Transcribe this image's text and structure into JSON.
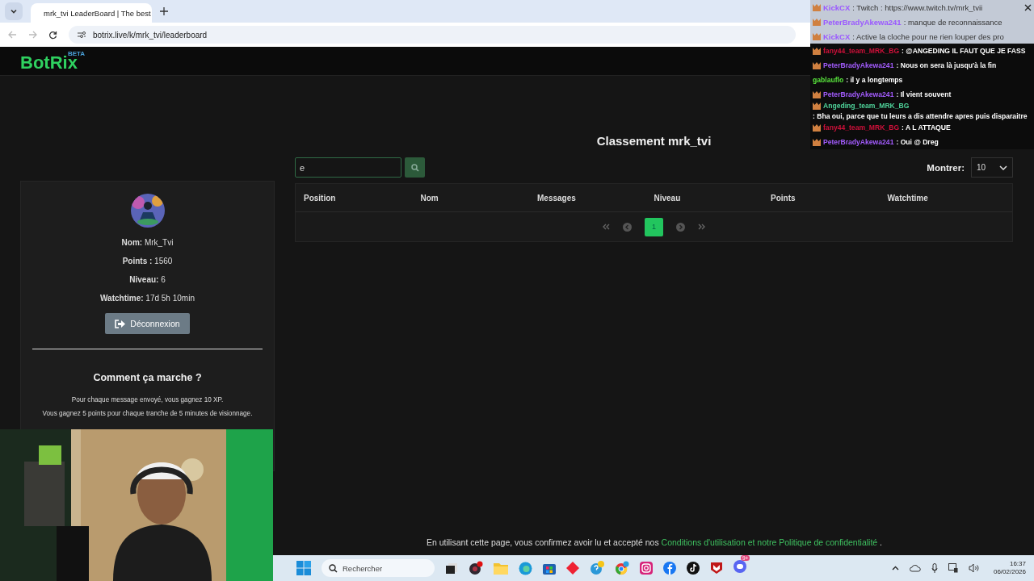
{
  "browser": {
    "tab_title": "mrk_tvi LeaderBoard | The best",
    "url": "botrix.live/k/mrk_tvi/leaderboard"
  },
  "header": {
    "logo": "BotRix",
    "logo_badge": "BETA"
  },
  "profile": {
    "fields": [
      {
        "label": "Nom:",
        "value": "Mrk_Tvi"
      },
      {
        "label": "Points :",
        "value": "1560"
      },
      {
        "label": "Niveau:",
        "value": "6"
      },
      {
        "label": "Watchtime:",
        "value": "17d 5h 10min"
      }
    ],
    "logout_button": "Déconnexion",
    "how_title": "Comment ça marche ?",
    "how_lines": [
      "Pour chaque message envoyé, vous gagnez 10 XP.",
      "Vous gagnez 5 points pour chaque tranche de 5 minutes de visionnage."
    ]
  },
  "leaderboard": {
    "title": "Classement mrk_tvi",
    "search": {
      "value": "e"
    },
    "show_label": "Montrer:",
    "show_value": "10",
    "columns": [
      "Position",
      "Nom",
      "Messages",
      "Niveau",
      "Points",
      "Watchtime"
    ],
    "pages": [
      {
        "label": "1",
        "selected": true
      }
    ]
  },
  "footer": {
    "text": "En utilisant cette page, vous confirmez avoir lu et accepté nos",
    "link": "Conditions d'utilisation et notre Politique de confidentialité",
    "end": "."
  },
  "chat": [
    {
      "name": "KickCX",
      "text": ": Twitch : https://www.twitch.tv/mrk_tvii",
      "color": "#9b59ff",
      "pinned": true,
      "badge": true
    },
    {
      "name": "PeterBradyAkewa241",
      "text": ": manque de reconnaissance",
      "color": "#9b59ff",
      "pinned": true,
      "badge": true
    },
    {
      "name": "KickCX",
      "text": ": Active la cloche pour ne rien louper des pro",
      "color": "#9b59ff",
      "pinned": true,
      "badge": true
    },
    {
      "name": "fany44_team_MRK_BG",
      "text": ": @ANGEDING IL FAUT QUE JE FASS",
      "color": "#d0103a",
      "pinned": false,
      "badge": true
    },
    {
      "name": "PeterBradyAkewa241",
      "text": ": Nous on sera là jusqu'à la fin",
      "color": "#a45cff",
      "pinned": false,
      "badge": true
    },
    {
      "name": "gablauflo",
      "text": ": il y a longtemps",
      "color": "#58e33c",
      "pinned": false,
      "badge": false
    },
    {
      "name": "PeterBradyAkewa241",
      "text": ": Il vient souvent",
      "color": "#a45cff",
      "pinned": false,
      "badge": true
    },
    {
      "name": "Angeding_team_MRK_BG",
      "text": ": Bha oui, parce que tu leurs a dis attendre apres puis disparaitre",
      "color": "#4fd39a",
      "pinned": false,
      "badge": true
    },
    {
      "name": "fany44_team_MRK_BG",
      "text": ": A L ATTAQUE",
      "color": "#d0103a",
      "pinned": false,
      "badge": true
    },
    {
      "name": "PeterBradyAkewa241",
      "text": ": Oui @ Dreg",
      "color": "#a45cff",
      "pinned": false,
      "badge": true
    }
  ],
  "taskbar": {
    "search_placeholder": "Rechercher",
    "notification_badge": "9+",
    "time": "16:37",
    "date": "06/02/2026"
  }
}
